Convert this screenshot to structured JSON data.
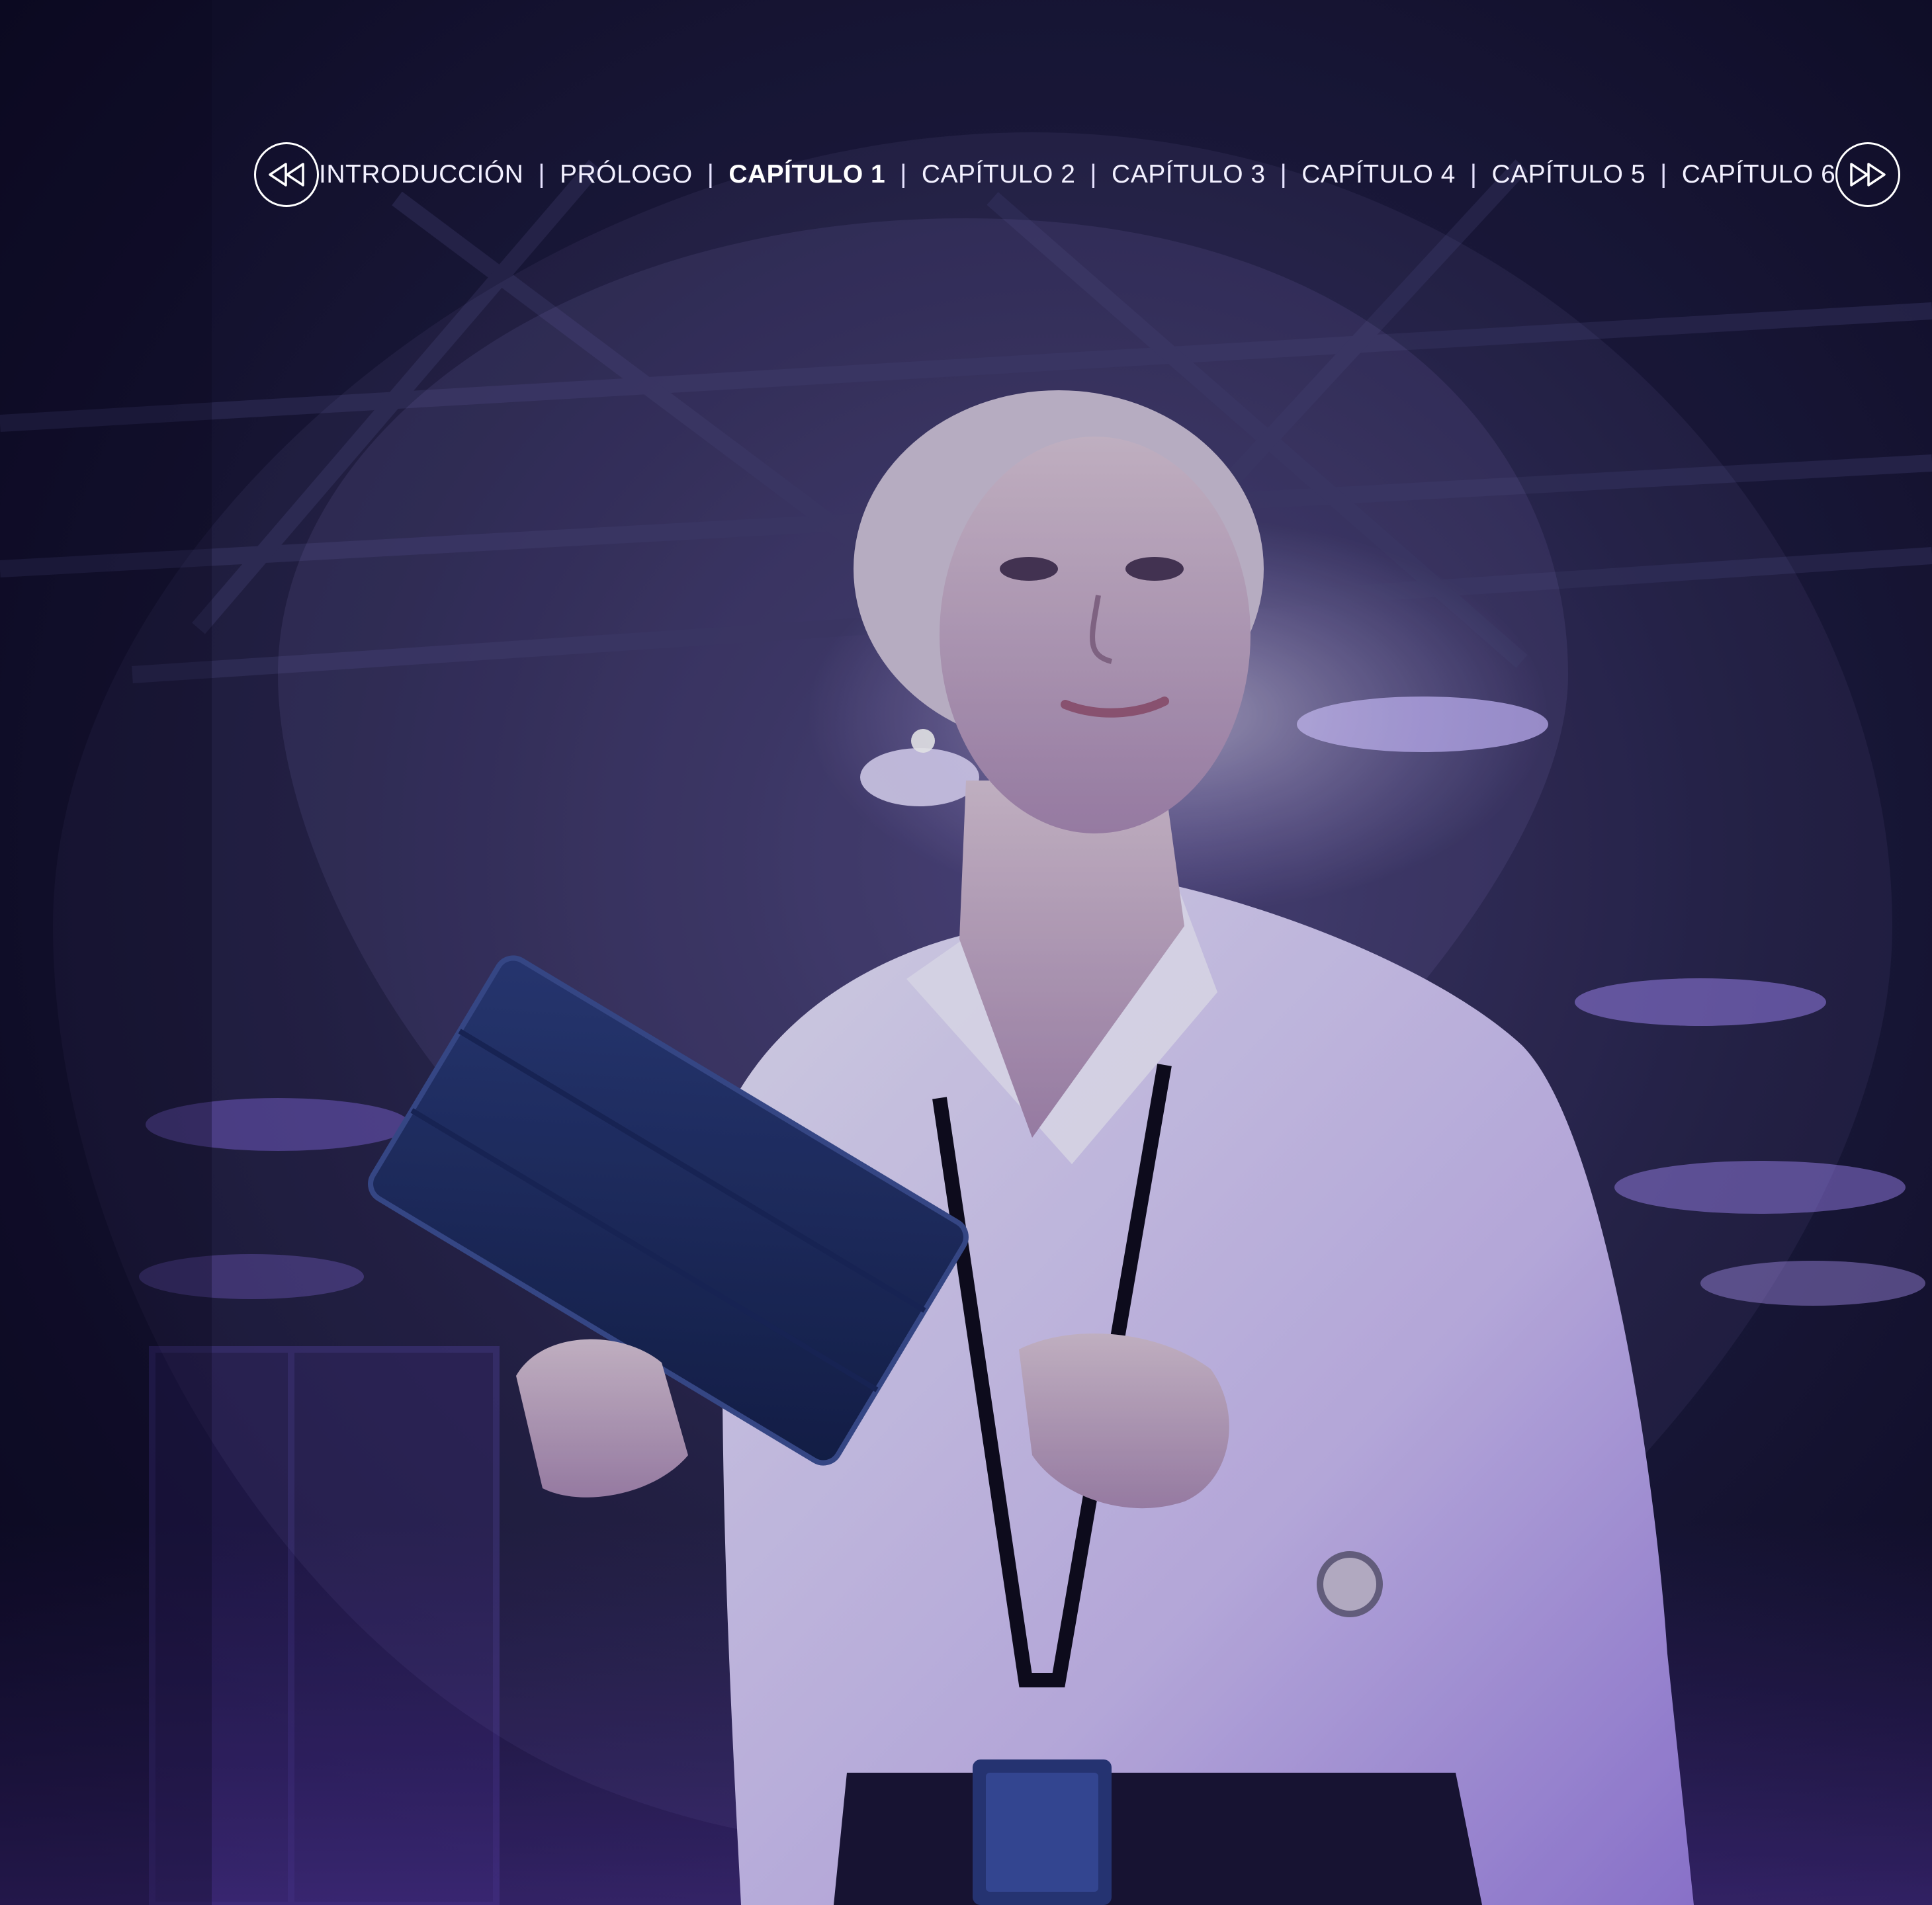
{
  "navigation": {
    "prev_icon": "rewind-icon",
    "next_icon": "fast-forward-icon",
    "separator": "|",
    "items": [
      {
        "label": "INTRODUCCIÓN",
        "active": false
      },
      {
        "label": "PRÓLOGO",
        "active": false
      },
      {
        "label": "CAPÍTULO 1",
        "active": true
      },
      {
        "label": "CAPÍTULO 2",
        "active": false
      },
      {
        "label": "CAPÍTULO 3",
        "active": false
      },
      {
        "label": "CAPÍTULO 4",
        "active": false
      },
      {
        "label": "CAPÍTULO 5",
        "active": false
      },
      {
        "label": "CAPÍTULO 6",
        "active": false
      }
    ]
  },
  "colors": {
    "background": "#0e0b24",
    "overlay_purple": "#7a5cd6",
    "nav_text": "#ffffff"
  }
}
